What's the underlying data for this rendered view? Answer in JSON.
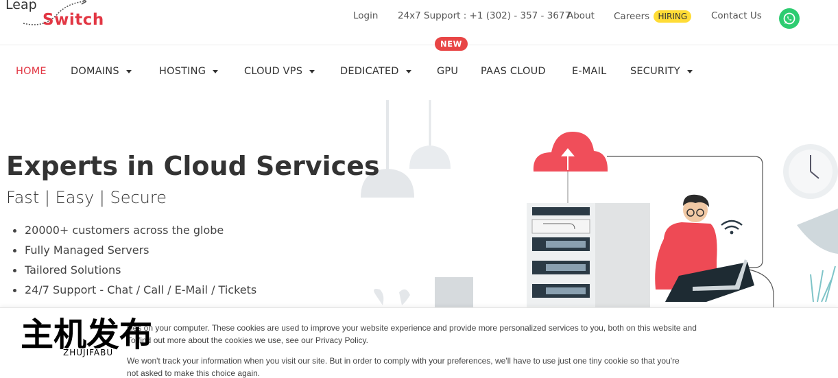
{
  "logo": {
    "line1": "Leap",
    "line2": "Switch"
  },
  "utility_nav": {
    "login": "Login",
    "support": "24x7 Support : +1 (302) - 357 - 3677",
    "about": "About",
    "careers": "Careers",
    "hiring_badge": "HIRING",
    "contact": "Contact Us",
    "whatsapp_icon": "whatsapp-icon"
  },
  "main_nav": {
    "items": [
      {
        "label": "HOME",
        "active": true,
        "dropdown": false
      },
      {
        "label": "DOMAINS",
        "dropdown": true
      },
      {
        "label": "HOSTING",
        "dropdown": true
      },
      {
        "label": "CLOUD VPS",
        "dropdown": true
      },
      {
        "label": "DEDICATED",
        "dropdown": true
      },
      {
        "label": "GPU",
        "dropdown": false,
        "badge": "NEW"
      },
      {
        "label": "PAAS CLOUD",
        "dropdown": false
      },
      {
        "label": "E-MAIL",
        "dropdown": false
      },
      {
        "label": "SECURITY",
        "dropdown": true
      }
    ]
  },
  "hero": {
    "title": "Experts in Cloud Services",
    "subtitle": "Fast | Easy | Secure",
    "bullets": [
      "20000+ customers across the globe",
      "Fully Managed Servers",
      "Tailored Solutions",
      "24/7 Support - Chat / Call / E-Mail / Tickets"
    ]
  },
  "cookie_banner": {
    "text1": "kies on your computer. These cookies are used to improve your website experience and provide more personalized services to you, both on this website and",
    "text1b": "To find out more about the cookies we use, see our Privacy Policy.",
    "text2": "We won't track your information when you visit our site. But in order to comply with your preferences, we'll have to use just one tiny cookie so that you're",
    "text2b": "not asked to make this choice again."
  },
  "watermark": {
    "chinese": "主机发布",
    "latin": "ZHUJIFABU"
  },
  "colors": {
    "brand_red": "#e23744",
    "hiring_yellow": "#ffdc36",
    "whatsapp_green": "#2ecc71"
  }
}
